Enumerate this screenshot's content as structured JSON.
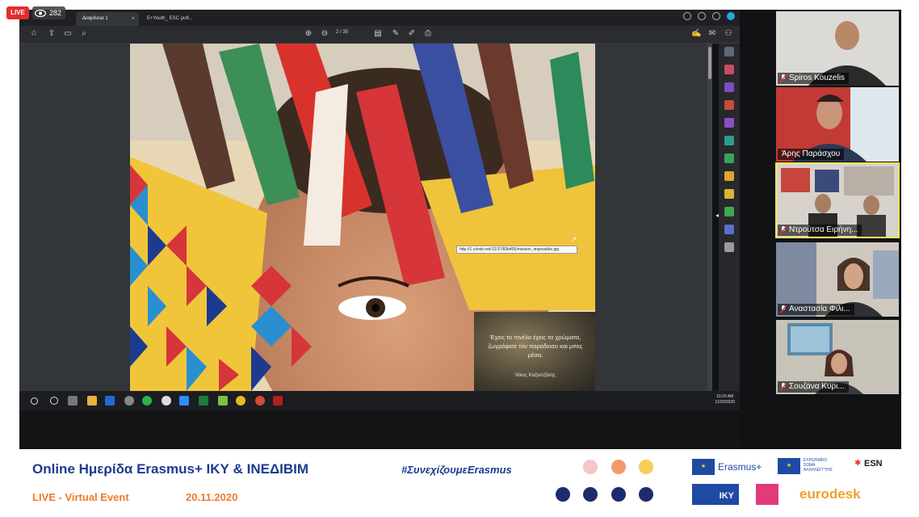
{
  "live_badge": {
    "label": "LIVE",
    "viewers": "282"
  },
  "browser": {
    "tabs": [
      {
        "label": "Διαφάνεια 1",
        "active": true
      },
      {
        "label": "E+Youth_ ESC ρυθ...",
        "active": false
      }
    ]
  },
  "pdf_viewer": {
    "page_current": "2",
    "page_separator": "/",
    "page_total": "35",
    "tooltip_url": "http://1.cdnsb.net/12/37/83b405/mission_impossible.jpg",
    "quote_lines": "Έχεις το πινέλο έχεις τα χρώματα, ζωγράφισε τον παράδεισο και μπες μέσα.",
    "quote_author": "Νίκος Καζαντζάκης"
  },
  "taskbar": {
    "time": "10:20 AM",
    "date": "11/20/2020"
  },
  "participants": [
    {
      "name": "Spiros Kouzelis",
      "muted": true
    },
    {
      "name": "Άρης Παράσχου",
      "muted": false
    },
    {
      "name": "Ντρούτσα Ειρήνη...",
      "muted": true,
      "speaking": true
    },
    {
      "name": "Αναστασία Φιλι...",
      "muted": true
    },
    {
      "name": "Σουζάνα Κυρι...",
      "muted": true
    }
  ],
  "banner": {
    "title": "Online Ημερίδα Erasmus+ ΙΚΥ & ΙΝΕΔΙΒΙΜ",
    "live_label": "LIVE - Virtual Event",
    "date": "20.11.2020",
    "hashtag": "#ΣυνεχίζουμεErasmus",
    "logos": {
      "erasmus": "Erasmus+",
      "esc_line1": "ΕΥΡΩΠΑΪΚΟ",
      "esc_line2": "ΣΩΜΑ",
      "esc_line3": "ΑΛΛΗΛΕΓΓΥΗΣ",
      "esn": "ESN",
      "iky": "IKY",
      "eurodesk": "eurodesk"
    },
    "dot_colors_top": [
      "#f6c6c6",
      "#f39a6b",
      "#f6cd57"
    ],
    "dot_color_bottom": "#1d2b6e"
  },
  "colors": {
    "live_red": "#e52c2c",
    "banner_blue": "#1d3b8e",
    "banner_orange": "#f07a2a",
    "active_speaker": "#f4e65a"
  }
}
